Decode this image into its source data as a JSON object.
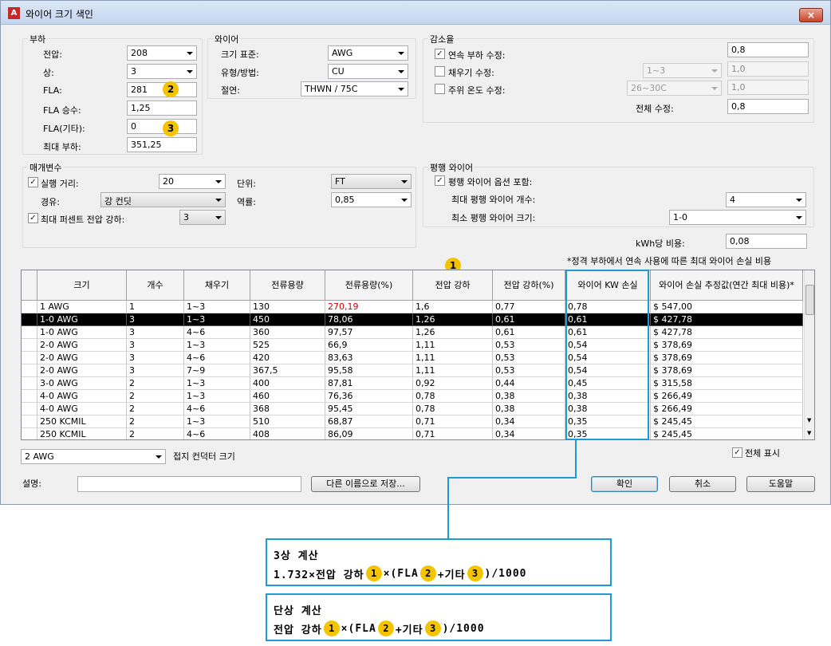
{
  "window": {
    "title": "와이어 크기 색인",
    "close": "×"
  },
  "load": {
    "title": "부하",
    "voltage_label": "전압:",
    "voltage": "208",
    "phase_label": "상:",
    "phase": "3",
    "fla_label": "FLA:",
    "fla": "281",
    "fla_mult_label": "FLA 승수:",
    "fla_mult": "1,25",
    "fla_other_label": "FLA(기타):",
    "fla_other": "0",
    "max_load_label": "최대 부하:",
    "max_load": "351,25"
  },
  "wire": {
    "title": "와이어",
    "size_std_label": "크기 표준:",
    "size_std": "AWG",
    "type_label": "유형/방법:",
    "type": "CU",
    "insulation_label": "절연:",
    "insulation": "THWN / 75C"
  },
  "derate": {
    "title": "감소율",
    "continuous_label": "연속 부하 수정:",
    "continuous_checked": true,
    "continuous": "0,8",
    "fill_label": "채우기 수정:",
    "fill_checked": false,
    "fill_range": "1~3",
    "fill": "1,0",
    "ambient_label": "주위 온도 수정:",
    "ambient_checked": false,
    "ambient_range": "26~30C",
    "ambient": "1,0",
    "total_label": "전체 수정:",
    "total": "0,8"
  },
  "params": {
    "title": "매개변수",
    "run_label": "실행 거리:",
    "run_checked": true,
    "run": "20",
    "unit_label": "단위:",
    "unit": "FT",
    "conduit_label": "경유:",
    "conduit": "강 컨딧",
    "pf_label": "역률:",
    "pf": "0,85",
    "vdrop_label": "최대 퍼센트 전압 강하:",
    "vdrop_checked": true,
    "vdrop": "3"
  },
  "parallel": {
    "title": "평행 와이어",
    "include_label": "평행 와이어 옵션 포함:",
    "include_checked": true,
    "max_count_label": "최대 평행 와이어 개수:",
    "max_count": "4",
    "min_size_label": "최소 평행 와이어 크기:",
    "min_size": "1-0"
  },
  "kwh": {
    "label": "kWh당 비용:",
    "value": "0,08"
  },
  "note": "*정격 부하에서 연속 사용에 따른 최대 와이어 손실 비용",
  "table": {
    "headers": [
      "크기",
      "개수",
      "채우기",
      "전류용량",
      "전류용량(%)",
      "전압 강하",
      "전압 강하(%)",
      "와이어 KW 손실",
      "와이어 손실 추정값(연간 최대 비용)*"
    ],
    "rows": [
      [
        "1 AWG",
        "1",
        "1~3",
        "130",
        "270,19",
        "1,6",
        "0,77",
        "0,78",
        "$ 547,00"
      ],
      [
        "1-0 AWG",
        "3",
        "1~3",
        "450",
        "78,06",
        "1,26",
        "0,61",
        "0,61",
        "$ 427,78"
      ],
      [
        "1-0 AWG",
        "3",
        "4~6",
        "360",
        "97,57",
        "1,26",
        "0,61",
        "0,61",
        "$ 427,78"
      ],
      [
        "2-0 AWG",
        "3",
        "1~3",
        "525",
        "66,9",
        "1,11",
        "0,53",
        "0,54",
        "$ 378,69"
      ],
      [
        "2-0 AWG",
        "3",
        "4~6",
        "420",
        "83,63",
        "1,11",
        "0,53",
        "0,54",
        "$ 378,69"
      ],
      [
        "2-0 AWG",
        "3",
        "7~9",
        "367,5",
        "95,58",
        "1,11",
        "0,53",
        "0,54",
        "$ 378,69"
      ],
      [
        "3-0 AWG",
        "2",
        "1~3",
        "400",
        "87,81",
        "0,92",
        "0,44",
        "0,45",
        "$ 315,58"
      ],
      [
        "4-0 AWG",
        "2",
        "1~3",
        "460",
        "76,36",
        "0,78",
        "0,38",
        "0,38",
        "$ 266,49"
      ],
      [
        "4-0 AWG",
        "2",
        "4~6",
        "368",
        "95,45",
        "0,78",
        "0,38",
        "0,38",
        "$ 266,49"
      ],
      [
        "250 KCMIL",
        "2",
        "1~3",
        "510",
        "68,87",
        "0,71",
        "0,34",
        "0,35",
        "$ 245,45"
      ],
      [
        "250 KCMIL",
        "2",
        "4~6",
        "408",
        "86,09",
        "0,71",
        "0,34",
        "0,35",
        "$ 245,45"
      ]
    ],
    "selected_row": 1,
    "overloaded_row": 0
  },
  "ground": {
    "value": "2 AWG",
    "label": "접지 컨덕터 크기"
  },
  "show_all": {
    "label": "전체 표시",
    "checked": true
  },
  "desc": {
    "label": "설명:",
    "value": ""
  },
  "buttons": {
    "save_as": "다른 이름으로 저장...",
    "ok": "확인",
    "cancel": "취소",
    "help": "도움말"
  },
  "markers": {
    "one": "1",
    "two": "2",
    "three": "3"
  },
  "calc_3phase": {
    "title": "3상 계산",
    "prefix": "1.732×전압 강하",
    "mid1": "×(FLA",
    "mid2": "+기타",
    "suffix": ")/1000"
  },
  "calc_1phase": {
    "title": "단상 계산",
    "prefix": "전압 강하",
    "mid1": "×(FLA",
    "mid2": "+기타",
    "suffix": ")/1000"
  },
  "colors": {
    "accent_blue": "#1e9ad6",
    "marker_yellow": "#f5c400",
    "overload_red": "#d00000"
  }
}
